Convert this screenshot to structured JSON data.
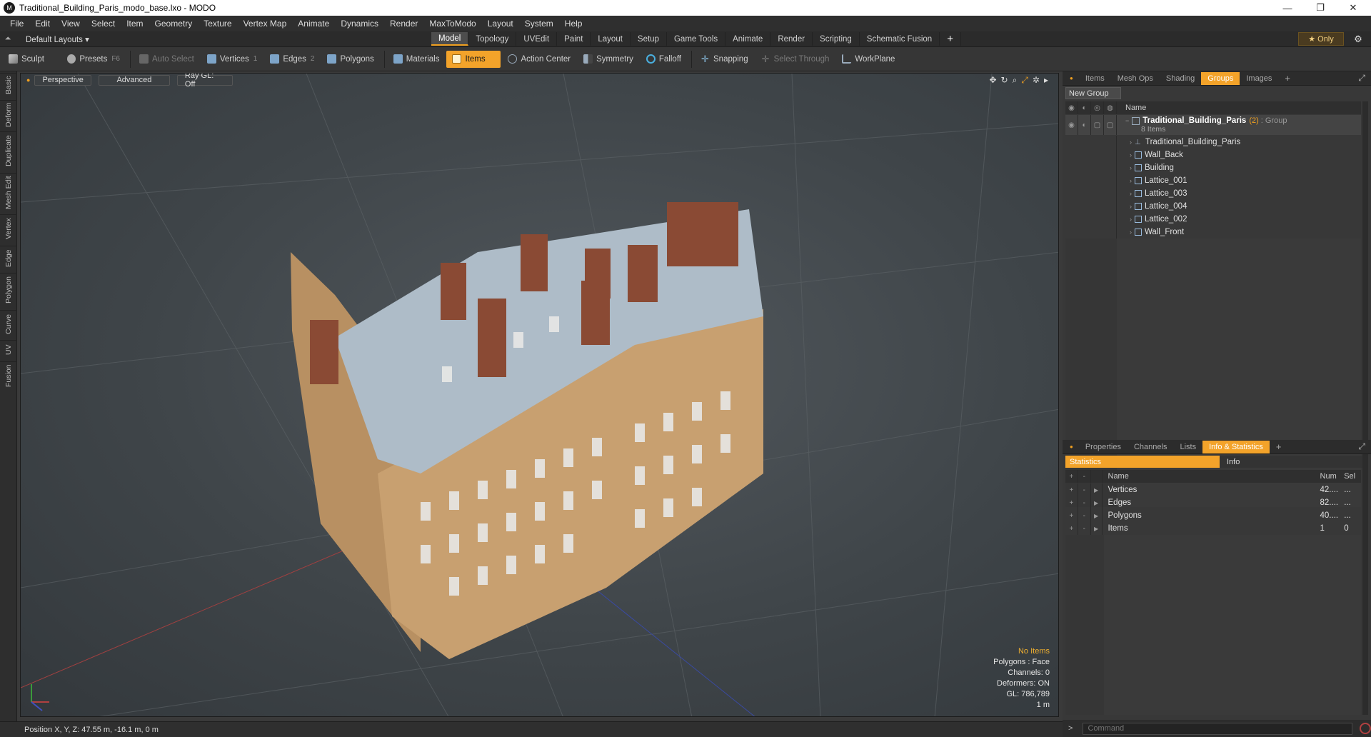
{
  "window": {
    "title": "Traditional_Building_Paris_modo_base.lxo - MODO",
    "app_icon": "modo-logo",
    "minimize": "—",
    "maximize": "❐",
    "close": "✕"
  },
  "menu": [
    "File",
    "Edit",
    "View",
    "Select",
    "Item",
    "Geometry",
    "Texture",
    "Vertex Map",
    "Animate",
    "Dynamics",
    "Render",
    "MaxToModo",
    "Layout",
    "System",
    "Help"
  ],
  "layouts": {
    "default_label": "Default Layouts ▾",
    "tabs": [
      "Model",
      "Topology",
      "UVEdit",
      "Paint",
      "Layout",
      "Setup",
      "Game Tools",
      "Animate",
      "Render",
      "Scripting",
      "Schematic Fusion"
    ],
    "active": "Model",
    "add": "+",
    "only_label": "★  Only",
    "gear": "⚙"
  },
  "toolbar": {
    "sculpt": "Sculpt",
    "presets": "Presets",
    "presets_key": "F6",
    "auto_select": "Auto Select",
    "vertices": "Vertices",
    "vertices_count": "1",
    "edges": "Edges",
    "edges_count": "2",
    "polygons": "Polygons",
    "materials": "Materials",
    "items": "Items",
    "action_center": "Action Center",
    "symmetry": "Symmetry",
    "falloff": "Falloff",
    "snapping": "Snapping",
    "select_through": "Select Through",
    "workplane": "WorkPlane"
  },
  "left_tabs": [
    "Basic",
    "Deform",
    "Duplicate",
    "Mesh Edit",
    "Vertex",
    "Edge",
    "Polygon",
    "Curve",
    "UV",
    "Fusion"
  ],
  "viewport": {
    "perspective": "Perspective",
    "advanced": "Advanced",
    "raygl": "Ray GL: Off",
    "info": {
      "no_items": "No Items",
      "polygons": "Polygons : Face",
      "channels": "Channels: 0",
      "deformers": "Deformers: ON",
      "gl": "GL: 786,789",
      "scale": "1 m"
    }
  },
  "status": {
    "position": "Position X, Y, Z:  47.55 m, -16.1 m, 0 m"
  },
  "groups_panel": {
    "tabs": [
      "Items",
      "Mesh Ops",
      "Shading",
      "Groups",
      "Images"
    ],
    "active": "Groups",
    "new_group": "New Group",
    "name_header": "Name",
    "group_name": "Traditional_Building_Paris",
    "group_count": "(2)",
    "group_type": ": Group",
    "group_sub": "8 Items",
    "items": [
      "Traditional_Building_Paris",
      "Wall_Back",
      "Building",
      "Lattice_001",
      "Lattice_003",
      "Lattice_004",
      "Lattice_002",
      "Wall_Front"
    ]
  },
  "stats_panel": {
    "tabs": [
      "Properties",
      "Channels",
      "Lists",
      "Info & Statistics"
    ],
    "active": "Info & Statistics",
    "sub_tabs": [
      "Statistics",
      "Info"
    ],
    "headers": {
      "name": "Name",
      "num": "Num",
      "sel": "Sel"
    },
    "rows": [
      {
        "name": "Vertices",
        "num": "42....",
        "sel": "..."
      },
      {
        "name": "Edges",
        "num": "82....",
        "sel": "..."
      },
      {
        "name": "Polygons",
        "num": "40....",
        "sel": "..."
      },
      {
        "name": "Items",
        "num": "1",
        "sel": "0"
      }
    ]
  },
  "command": {
    "placeholder": "Command"
  },
  "colors": {
    "accent": "#f3a32a",
    "panel": "#383838",
    "viewport": "#454b4f"
  }
}
